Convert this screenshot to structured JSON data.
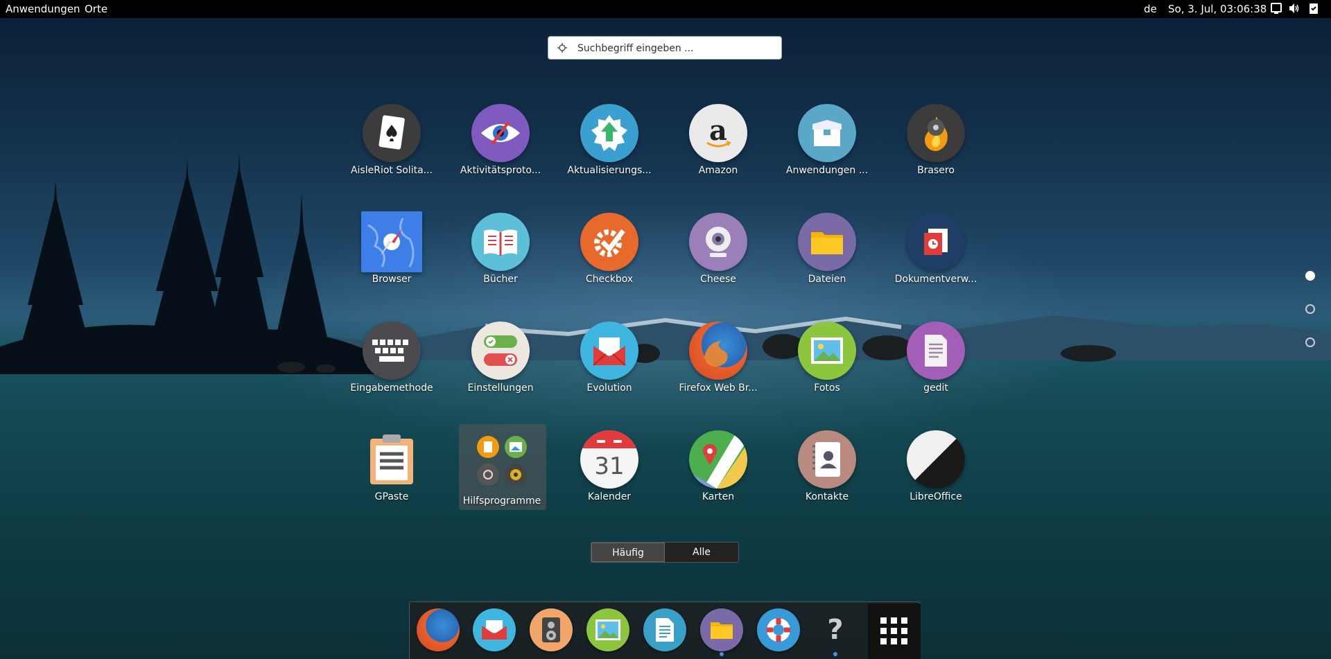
{
  "topbar": {
    "applications_menu": "Anwendungen",
    "places_menu": "Orte",
    "keyboard_layout": "de",
    "clock": "So,  3. Jul, 03:06:38"
  },
  "search": {
    "placeholder": "Suchbegriff eingeben ..."
  },
  "apps": [
    {
      "label": "AisleRiot Solita...",
      "icon": "cards-icon"
    },
    {
      "label": "Aktivitätsproto...",
      "icon": "eye-icon"
    },
    {
      "label": "Aktualisierungs...",
      "icon": "update-arrow-icon"
    },
    {
      "label": "Amazon",
      "icon": "amazon-icon"
    },
    {
      "label": "Anwendungen ...",
      "icon": "software-box-icon"
    },
    {
      "label": "Brasero",
      "icon": "brasero-flame-icon"
    },
    {
      "label": "Browser",
      "icon": "compass-icon"
    },
    {
      "label": "Bücher",
      "icon": "book-icon"
    },
    {
      "label": "Checkbox",
      "icon": "gear-check-icon"
    },
    {
      "label": "Cheese",
      "icon": "webcam-icon"
    },
    {
      "label": "Dateien",
      "icon": "folder-icon"
    },
    {
      "label": "Dokumentverw...",
      "icon": "document-icon"
    },
    {
      "label": "Eingabemethode",
      "icon": "keyboard-icon"
    },
    {
      "label": "Einstellungen",
      "icon": "toggle-icon"
    },
    {
      "label": "Evolution",
      "icon": "mail-icon"
    },
    {
      "label": "Firefox Web Br...",
      "icon": "firefox-icon"
    },
    {
      "label": "Fotos",
      "icon": "photo-icon"
    },
    {
      "label": "gedit",
      "icon": "text-editor-icon"
    },
    {
      "label": "GPaste",
      "icon": "clipboard-icon"
    },
    {
      "label": "Hilfsprogramme",
      "icon": "utilities-folder-icon"
    },
    {
      "label": "Kalender",
      "icon": "calendar-icon",
      "day": "31"
    },
    {
      "label": "Karten",
      "icon": "map-icon"
    },
    {
      "label": "Kontakte",
      "icon": "contacts-icon"
    },
    {
      "label": "LibreOffice",
      "icon": "libreoffice-icon"
    }
  ],
  "view_switcher": {
    "frequent": "Häufig",
    "all": "Alle",
    "active": "frequent"
  },
  "page_indicator": {
    "pages": 3,
    "current": 1
  },
  "dock": [
    {
      "icon": "firefox-icon",
      "running": false
    },
    {
      "icon": "mail-icon",
      "running": false
    },
    {
      "icon": "speaker-icon",
      "running": false
    },
    {
      "icon": "photo-icon",
      "running": false
    },
    {
      "icon": "text-editor-icon",
      "running": false
    },
    {
      "icon": "folder-icon",
      "running": true
    },
    {
      "icon": "help-lifebuoy-icon",
      "running": false
    },
    {
      "icon": "unknown-app-icon",
      "running": true
    },
    {
      "icon": "app-grid-icon",
      "running": false
    }
  ],
  "unknown_glyph": "?"
}
